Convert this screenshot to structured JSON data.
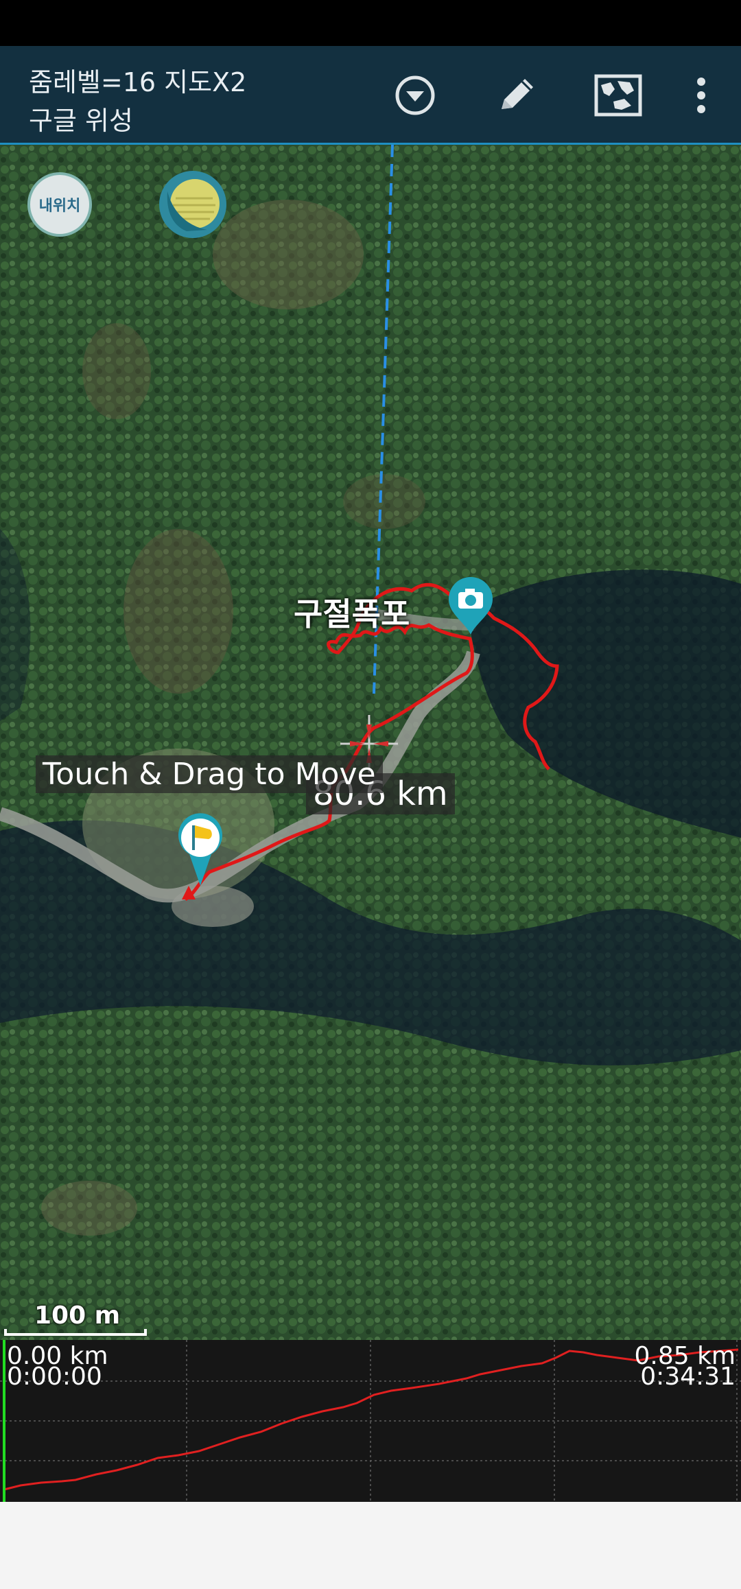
{
  "app": {
    "title_line1": "줌레벨=16 지도X2",
    "title_line2": "구글 위성"
  },
  "toolbar": {
    "icons": [
      "dropdown-circle-icon",
      "pencil-icon",
      "map-icon",
      "more-vert-icon"
    ]
  },
  "map": {
    "my_location_label": "내위치",
    "place_label": "구절폭포",
    "drag_hint": "Touch & Drag to Move",
    "distance_label": "80.6 km",
    "scale_label": "100 m",
    "colors": {
      "track": "#e01818",
      "guide_line": "#2a8fe6",
      "marker": "#1fa3b8"
    }
  },
  "profile": {
    "start_distance": "0.00 km",
    "start_time": "0:00:00",
    "end_distance": "0.85 km",
    "end_time": "0:34:31",
    "colors": {
      "line": "#e02020",
      "cursor": "#22dd22"
    }
  }
}
